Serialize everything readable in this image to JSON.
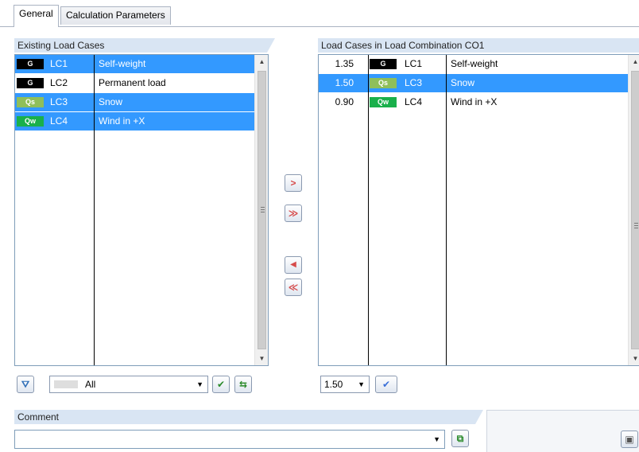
{
  "tabs": [
    {
      "label": "General",
      "active": true
    },
    {
      "label": "Calculation Parameters",
      "active": false
    }
  ],
  "existing": {
    "header": "Existing Load Cases",
    "rows": [
      {
        "badge": "G",
        "badge_color": "#000000",
        "badge_text_color": "#ffffff",
        "lc": "LC1",
        "desc": "Self-weight",
        "selected": true
      },
      {
        "badge": "G",
        "badge_color": "#000000",
        "badge_text_color": "#ffffff",
        "lc": "LC2",
        "desc": "Permanent load",
        "selected": false
      },
      {
        "badge": "Qs",
        "badge_color": "#8fbf5a",
        "badge_text_color": "#ffffff",
        "lc": "LC3",
        "desc": "Snow",
        "selected": true
      },
      {
        "badge": "Qw",
        "badge_color": "#19b04b",
        "badge_text_color": "#ffffff",
        "lc": "LC4",
        "desc": "Wind in +X",
        "selected": true
      }
    ],
    "filter_value": "All"
  },
  "combo": {
    "header": "Load Cases in Load Combination CO1",
    "rows": [
      {
        "factor": "1.35",
        "badge": "G",
        "badge_color": "#000000",
        "badge_text_color": "#ffffff",
        "lc": "LC1",
        "desc": "Self-weight",
        "selected": false
      },
      {
        "factor": "1.50",
        "badge": "Qs",
        "badge_color": "#8fbf5a",
        "badge_text_color": "#ffffff",
        "lc": "LC3",
        "desc": "Snow",
        "selected": true
      },
      {
        "factor": "0.90",
        "badge": "Qw",
        "badge_color": "#19b04b",
        "badge_text_color": "#ffffff",
        "lc": "LC4",
        "desc": "Wind in +X",
        "selected": false
      }
    ],
    "factor_value": "1.50"
  },
  "move_buttons": {
    "add": ">",
    "add_all": "≫",
    "remove": "◀",
    "remove_all": "≪"
  },
  "comment": {
    "label": "Comment",
    "value": ""
  },
  "colors": {
    "selection": "#3399ff",
    "header_bg": "#d9e5f3"
  }
}
